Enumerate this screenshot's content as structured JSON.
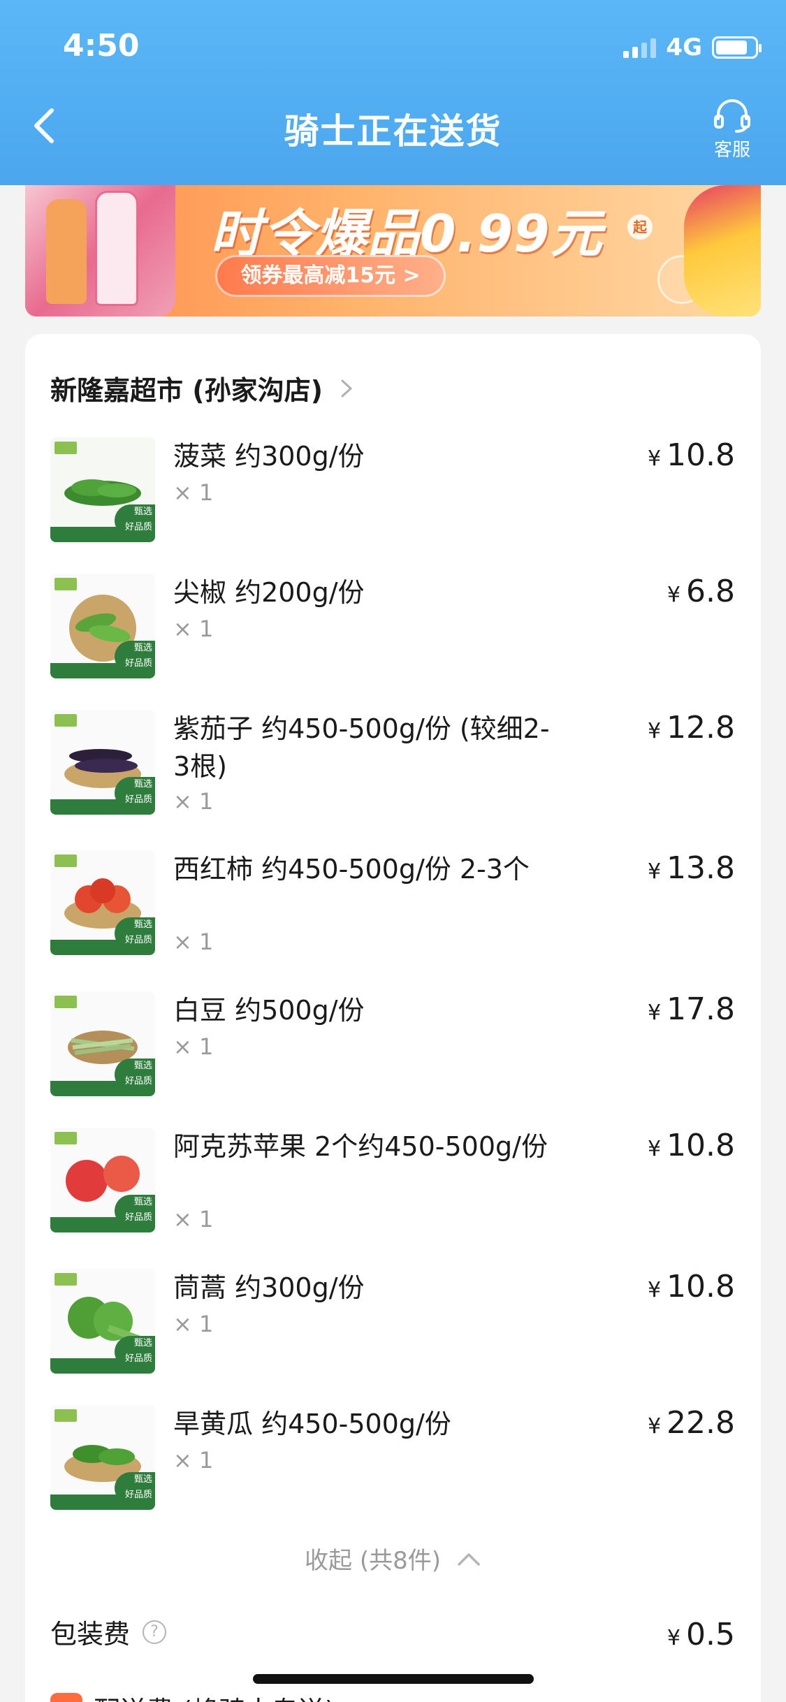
{
  "status_bar": {
    "time": "4:50",
    "network": "4G"
  },
  "header": {
    "title": "骑士正在送货",
    "service_label": "客服"
  },
  "banner": {
    "headline": "时令爆品0.99元",
    "badge": "起",
    "coupon_label": "领券最高减15元 >"
  },
  "store": {
    "name": "新隆嘉超市 (孙家沟店)"
  },
  "items": [
    {
      "name": "菠菜 约300g/份",
      "qty": "× 1",
      "price": "10.8"
    },
    {
      "name": "尖椒 约200g/份",
      "qty": "× 1",
      "price": "6.8"
    },
    {
      "name": "紫茄子 约450-500g/份 (较细2-3根)",
      "qty": "× 1",
      "price": "12.8"
    },
    {
      "name": "西红柿 约450-500g/份 2-3个",
      "qty": "× 1",
      "price": "13.8"
    },
    {
      "name": "白豆 约500g/份",
      "qty": "× 1",
      "price": "17.8"
    },
    {
      "name": "阿克苏苹果 2个约450-500g/份",
      "qty": "× 1",
      "price": "10.8"
    },
    {
      "name": "茼蒿 约300g/份",
      "qty": "× 1",
      "price": "10.8"
    },
    {
      "name": "旱黄瓜 约450-500g/份",
      "qty": "× 1",
      "price": "22.8"
    }
  ],
  "currency_symbol": "¥",
  "collapse_label": "收起 (共8件)",
  "packaging_fee": {
    "label": "包装费",
    "price": "0.5"
  },
  "delivery_fee": {
    "label": "配送费 (蜂骑士专送)"
  },
  "colors": {
    "header_blue": "#4ba6ee",
    "badge_green": "#2f7d3c"
  }
}
